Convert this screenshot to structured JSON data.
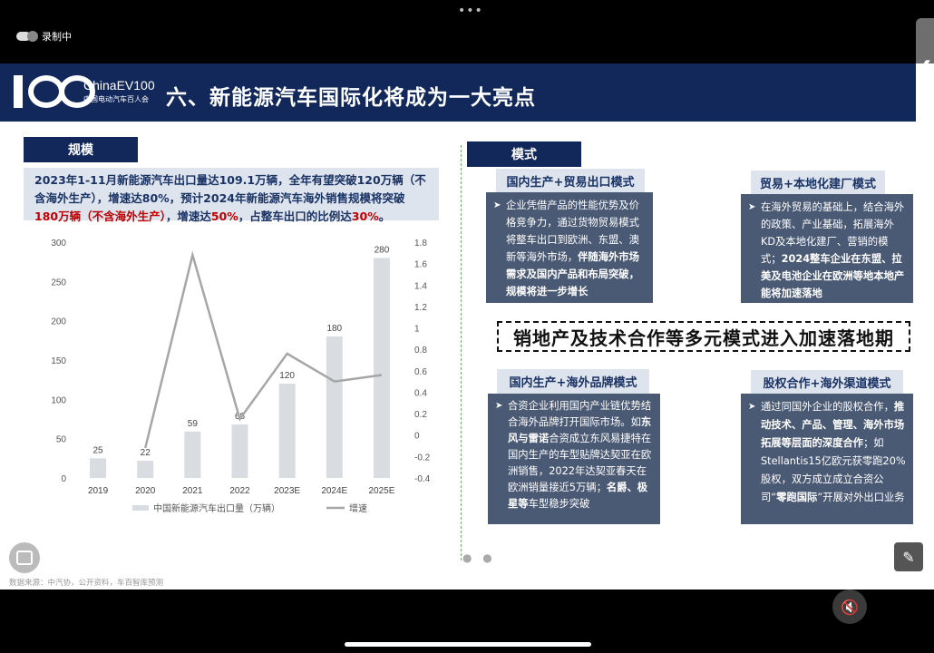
{
  "status": {
    "recording_label": "录制中",
    "top_dots": "•••"
  },
  "slide": {
    "logo_text": "ChinaEV100",
    "logo_subtext": "中国电动汽车百人会",
    "title": "六、新能源汽车国际化将成为一大亮点",
    "left_section_label": "规模",
    "right_section_label": "模式",
    "summary": {
      "p1": "2023年1-11月新能源汽车出口量达109.1万辆，全年有望突破120万辆（不含海外生产），增速达80%，预计2024年新能源汽车海外销售规模将突破",
      "r1": "180万辆（不含海外生产）",
      "p2": "，增速达",
      "r2": "50%",
      "p3": "，占整车出口的比例达",
      "r3": "30%",
      "p4": "。"
    },
    "center_banner": "销地产及技术合作等多元模式进入加速落地期",
    "source": "数据来源：中汽协，公开资料，车百智库预测",
    "cards": [
      {
        "title": "国内生产+贸易出口模式",
        "text_plain": "企业凭借产品的性能优势及价格竞争力，通过货物贸易模式将整车出口到欧洲、东盟、澳新等海外市场，",
        "text_bold": "伴随海外市场需求及国内产品和布局突破，规模将进一步增长",
        "text_tail": ""
      },
      {
        "title": "贸易+本地化建厂模式",
        "text_plain": "在海外贸易的基础上，结合海外的政策、产业基础，拓展海外KD及本地化建厂、营销的模式；",
        "text_bold": "2024整车企业在东盟、拉美及电池企业在欧洲等地本地产能将加速落地",
        "text_tail": ""
      },
      {
        "title": "国内生产+海外品牌模式",
        "text_plain": "合资企业利用国内产业链优势结合海外品牌打开国际市场。如",
        "text_bold": "东风与雷诺",
        "text_tail": "合资成立东风易捷特在国内生产的车型贴牌达契亚在欧洲销售，2022年达契亚春天在欧洲销量接近5万辆；",
        "text_bold2": "名爵、极星等",
        "text_tail2": "车型稳步突破"
      },
      {
        "title": "股权合作+海外渠道模式",
        "text_plain": "通过同国外企业的股权合作，",
        "text_bold": "推动技术、产品、管理、海外市场拓展等层面的深度合作",
        "text_tail": "；如Stellantis15亿欧元获零跑20%股权，双方成立成立合资公司“",
        "text_bold2": "零跑国际",
        "text_tail2": "”开展对外出口业务"
      }
    ]
  },
  "chart_data": {
    "type": "bar",
    "categories": [
      "2019",
      "2020",
      "2021",
      "2022",
      "2023E",
      "2024E",
      "2025E"
    ],
    "series": [
      {
        "name": "中国新能源汽车出口量（万辆）",
        "kind": "bar",
        "axis": "left",
        "values": [
          25,
          22,
          59,
          68,
          120,
          180,
          280
        ],
        "color": "#d9dce1"
      },
      {
        "name": "增速",
        "kind": "line",
        "axis": "right",
        "values": [
          null,
          -0.12,
          1.68,
          0.15,
          0.76,
          0.5,
          0.56
        ],
        "color": "#a6a6a6"
      }
    ],
    "ylim_left": [
      0,
      300
    ],
    "yticks_left": [
      0,
      50,
      100,
      150,
      200,
      250,
      300
    ],
    "ylim_right": [
      -0.4,
      1.8
    ],
    "yticks_right": [
      "-0.4",
      "-0.2",
      "0",
      "0.2",
      "0.4",
      "0.6",
      "0.8",
      "1",
      "1.2",
      "1.4",
      "1.6",
      "1.8"
    ],
    "data_labels": [
      "25",
      "22",
      "59",
      "68",
      "120",
      "180",
      "280"
    ],
    "legend_position": "bottom"
  },
  "icons": {
    "back": "chevron-left-icon",
    "edit": "expand-edit-icon",
    "chat": "chat-icon",
    "mic": "mic-muted-icon"
  }
}
